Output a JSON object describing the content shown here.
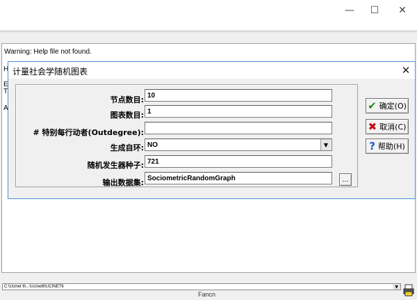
{
  "main_window": {
    "controls": {
      "minimize": "—",
      "maximize": "☐",
      "close": "✕"
    },
    "warning": "Warning: Help file not found.",
    "background_chars": [
      "H",
      "E",
      "T",
      "A"
    ]
  },
  "dialog": {
    "title": "计量社会学随机图表",
    "close_glyph": "✕",
    "fields": [
      {
        "label": "节点数目:",
        "value": "10"
      },
      {
        "label": "图表数目:",
        "value": "1"
      },
      {
        "label": "# 特别每行动者(Outdegree):",
        "value": ""
      },
      {
        "label": "生成自环:",
        "value": "NO"
      },
      {
        "label": "随机发生器种子:",
        "value": "721"
      },
      {
        "label": "输出数据集:",
        "value": "SociometricRandomGraph"
      }
    ],
    "browse_label": "...",
    "dropdown_glyph": "▼",
    "buttons": {
      "ok": {
        "label": "确定(O)",
        "icon": "checkmark-icon",
        "color": "#1a8f1a"
      },
      "cancel": {
        "label": "取消(C)",
        "icon": "x-icon",
        "color": "#c0111f"
      },
      "help": {
        "label": "帮助(H)",
        "icon": "question-icon",
        "color": "#1f5fbf"
      }
    }
  },
  "status_bar": {
    "path": "C:\\Ucinet 6\\...\\Ucinet6\\UCINET6",
    "dropdown_glyph": "▼",
    "label": "Fancn"
  },
  "colors": {
    "accent": "#4a90d9",
    "face": "#f0f0f0"
  }
}
